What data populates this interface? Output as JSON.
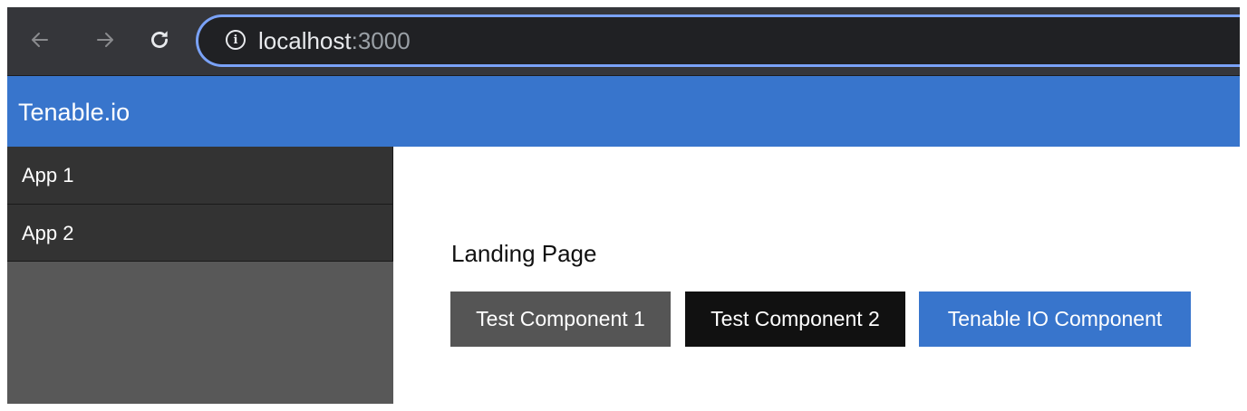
{
  "browser": {
    "back_icon": "arrow-left-icon",
    "forward_icon": "arrow-right-icon",
    "reload_icon": "reload-icon",
    "info_icon": "info-icon",
    "url_host": "localhost",
    "url_port": ":3000"
  },
  "header": {
    "title": "Tenable.io",
    "color": "#3875cc"
  },
  "sidebar": {
    "items": [
      {
        "label": "App 1"
      },
      {
        "label": "App 2"
      }
    ]
  },
  "main": {
    "heading": "Landing Page",
    "buttons": [
      {
        "label": "Test Component 1",
        "color": "#555555"
      },
      {
        "label": "Test Component 2",
        "color": "#111111"
      },
      {
        "label": "Tenable IO Component",
        "color": "#3875cc"
      }
    ]
  }
}
